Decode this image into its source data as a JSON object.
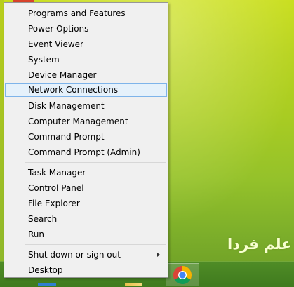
{
  "desktop": {
    "watermark": "علم فردا"
  },
  "context_menu": {
    "items": [
      {
        "label": "Programs and Features"
      },
      {
        "label": "Power Options"
      },
      {
        "label": "Event Viewer"
      },
      {
        "label": "System"
      },
      {
        "label": "Device Manager"
      },
      {
        "label": "Network Connections",
        "highlighted": true
      },
      {
        "label": "Disk Management"
      },
      {
        "label": "Computer Management"
      },
      {
        "label": "Command Prompt"
      },
      {
        "label": "Command Prompt (Admin)"
      },
      {
        "label": "Task Manager"
      },
      {
        "label": "Control Panel"
      },
      {
        "label": "File Explorer"
      },
      {
        "label": "Search"
      },
      {
        "label": "Run"
      },
      {
        "label": "Shut down or sign out",
        "icon": "chevron-right-icon"
      },
      {
        "label": "Desktop"
      }
    ]
  },
  "taskbar": {
    "items": [
      {
        "icon": "internet-explorer-icon"
      },
      {
        "icon": "file-explorer-icon"
      },
      {
        "icon": "chrome-icon",
        "active": true
      }
    ]
  },
  "colors": {
    "menu_background": "#f0f0f0",
    "highlight_background": "#e5f1fb",
    "highlight_border": "#7eb4ea",
    "desktop_green": "#a9cc22",
    "taskbar_green": "#437d20"
  }
}
